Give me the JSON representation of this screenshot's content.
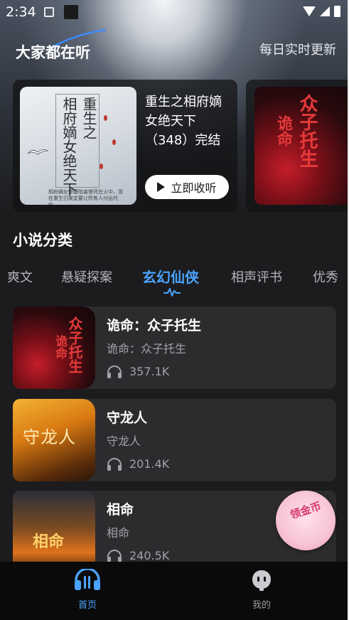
{
  "status_bar": {
    "time": "2:34"
  },
  "header": {
    "title": "大家都在听",
    "right_link": "每日实时更新"
  },
  "carousel": [
    {
      "cover_title_col1": "重生之",
      "cover_title_col2": "相府嫡女绝天下",
      "cover_blurb": "相府嫡女惨遭陷害惨死在火中，现在重生归来定要让所有人付出代价。",
      "title": "重生之相府嫡女绝天下（348）完结",
      "button_label": "立即收听"
    },
    {
      "cover_text_a": "诡命",
      "cover_text_b": "众子托生"
    }
  ],
  "section": {
    "title": "小说分类"
  },
  "tabs": [
    {
      "label": "爽文"
    },
    {
      "label": "悬疑探案"
    },
    {
      "label": "玄幻仙侠",
      "active": true
    },
    {
      "label": "相声评书"
    },
    {
      "label": "优秀"
    }
  ],
  "books": [
    {
      "title": "诡命：众子托生",
      "subtitle": "诡命：众子托生",
      "plays": "357.1K",
      "cover_text_a": "诡命",
      "cover_text_b": "众子托生"
    },
    {
      "title": "守龙人",
      "subtitle": "守龙人",
      "plays": "201.4K",
      "cover_text": "守龙人"
    },
    {
      "title": "相命",
      "subtitle": "相命",
      "plays": "240.5K",
      "cover_text": "相命"
    }
  ],
  "float_badge": {
    "text": "领金币"
  },
  "bottom_nav": [
    {
      "label": "首页",
      "active": true
    },
    {
      "label": "我的"
    }
  ],
  "colors": {
    "accent": "#4aa3ff",
    "card_bg": "#2c2c2e",
    "page_bg": "#1c1c1e"
  }
}
